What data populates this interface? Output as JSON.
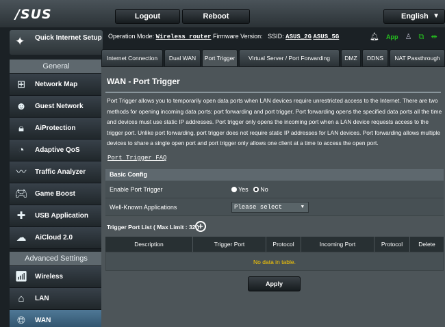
{
  "header": {
    "logo": "/SUS",
    "logout_label": "Logout",
    "reboot_label": "Reboot",
    "language": "English"
  },
  "sidebar": {
    "quick_setup": "Quick Internet Setup",
    "general_label": "General",
    "items": [
      {
        "label": "Network Map"
      },
      {
        "label": "Guest Network"
      },
      {
        "label": "AiProtection"
      },
      {
        "label": "Adaptive QoS"
      },
      {
        "label": "Traffic Analyzer"
      },
      {
        "label": "Game Boost"
      },
      {
        "label": "USB Application"
      },
      {
        "label": "AiCloud 2.0"
      }
    ],
    "advanced_label": "Advanced Settings",
    "advanced_items": [
      {
        "label": "Wireless"
      },
      {
        "label": "LAN"
      },
      {
        "label": "WAN"
      }
    ]
  },
  "status": {
    "op_mode_label": "Operation Mode:",
    "op_mode_value": "Wireless router",
    "fw_label": "Firmware Version:",
    "ssid_label": "SSID:",
    "ssid_2g": "ASUS_2G",
    "ssid_5g": "ASUS_5G",
    "app_label": "App"
  },
  "tabs": [
    {
      "label": "Internet Connection"
    },
    {
      "label": "Dual WAN"
    },
    {
      "label": "Port Trigger"
    },
    {
      "label": "Virtual Server / Port Forwarding"
    },
    {
      "label": "DMZ"
    },
    {
      "label": "DDNS"
    },
    {
      "label": "NAT Passthrough"
    }
  ],
  "page": {
    "title": "WAN - Port Trigger",
    "description": "Port Trigger allows you to temporarily open data ports when LAN devices require unrestricted access to the Internet. There are two methods for opening incoming data ports: port forwarding and port trigger. Port forwarding opens the specified data ports all the time and devices must use static IP addresses. Port trigger only opens the incoming port when a LAN device requests access to the trigger port. Unlike port forwarding, port trigger does not require static IP addresses for LAN devices. Port forwarding allows multiple devices to share a single open port and port trigger only allows one client at a time to access the open port.",
    "faq_link": "Port Trigger FAQ"
  },
  "basic_config": {
    "header": "Basic Config",
    "enable_label": "Enable Port Trigger",
    "yes_label": "Yes",
    "no_label": "No",
    "selected": "No",
    "apps_label": "Well-Known Applications",
    "apps_select": "Please select"
  },
  "trigger_list": {
    "title": "Trigger Port List ( Max Limit : 32 )",
    "columns": [
      "Description",
      "Trigger Port",
      "Protocol",
      "Incoming Port",
      "Protocol",
      "Delete"
    ],
    "empty_text": "No data in table."
  },
  "apply_label": "Apply"
}
